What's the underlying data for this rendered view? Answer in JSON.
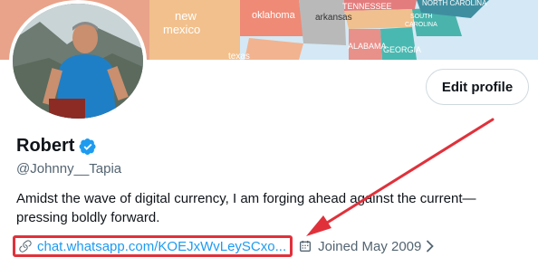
{
  "banner": {
    "map_labels": [
      "new",
      "mexico",
      "oklahoma",
      "arkansas",
      "TENNESSEE",
      "SOUTH",
      "CAROLINA",
      "NORTH CAROLINA",
      "ALABAMA",
      "GEORGIA",
      "texas"
    ]
  },
  "profile": {
    "edit_button_label": "Edit profile",
    "display_name": "Robert",
    "handle": "@Johnny__Tapia",
    "bio": "Amidst the wave of digital currency, I am forging ahead against the current—pressing boldly forward.",
    "website_link": "chat.whatsapp.com/KOEJxWvLeySCxo...",
    "joined": "Joined May 2009"
  },
  "colors": {
    "accent": "#1d9bf0",
    "highlight_annotation": "#e0313b",
    "secondary_text": "#536471"
  },
  "icons": [
    "verified-badge-icon",
    "link-icon",
    "calendar-icon",
    "chevron-right-icon"
  ]
}
